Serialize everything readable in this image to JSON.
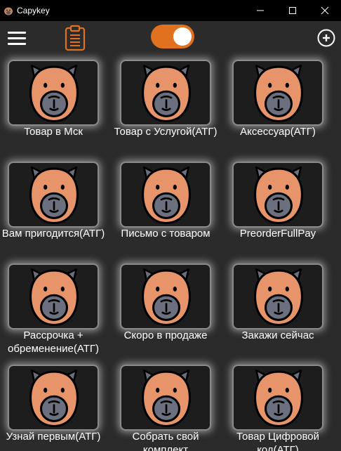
{
  "window": {
    "title": "Capykey",
    "app_icon": "capybara-icon",
    "controls": [
      "minimize-icon",
      "maximize-icon",
      "close-icon"
    ]
  },
  "toolbar": {
    "menu_icon": "hamburger-menu-icon",
    "clipboard_icon": "clipboard-icon",
    "toggle_state": "on",
    "add_icon": "plus-circle-icon"
  },
  "colors": {
    "accent": "#e0711f",
    "background": "#2b2b2b",
    "titlebar": "#000000",
    "text": "#ffffff"
  },
  "tiles": [
    {
      "label": "Товар в Мск",
      "icon": "capybara-icon"
    },
    {
      "label": "Товар с Услугой(АТГ)",
      "icon": "capybara-icon"
    },
    {
      "label": "Аксессуар(АТГ)",
      "icon": "capybara-icon"
    },
    {
      "label": "Вам пригодится(АТГ)",
      "icon": "capybara-icon"
    },
    {
      "label": "Письмо с товаром",
      "icon": "capybara-icon"
    },
    {
      "label": "PreorderFullPay",
      "icon": "capybara-icon"
    },
    {
      "label": "Рассрочка + обременение(АТГ)",
      "icon": "capybara-icon"
    },
    {
      "label": "Скоро в продаже",
      "icon": "capybara-icon"
    },
    {
      "label": "Закажи сейчас",
      "icon": "capybara-icon"
    },
    {
      "label": "Узнай первым(АТГ)",
      "icon": "capybara-icon"
    },
    {
      "label": "Собрать свой комплект",
      "icon": "capybara-icon"
    },
    {
      "label": "Товар Цифровой код(АТГ)",
      "icon": "capybara-icon"
    }
  ]
}
